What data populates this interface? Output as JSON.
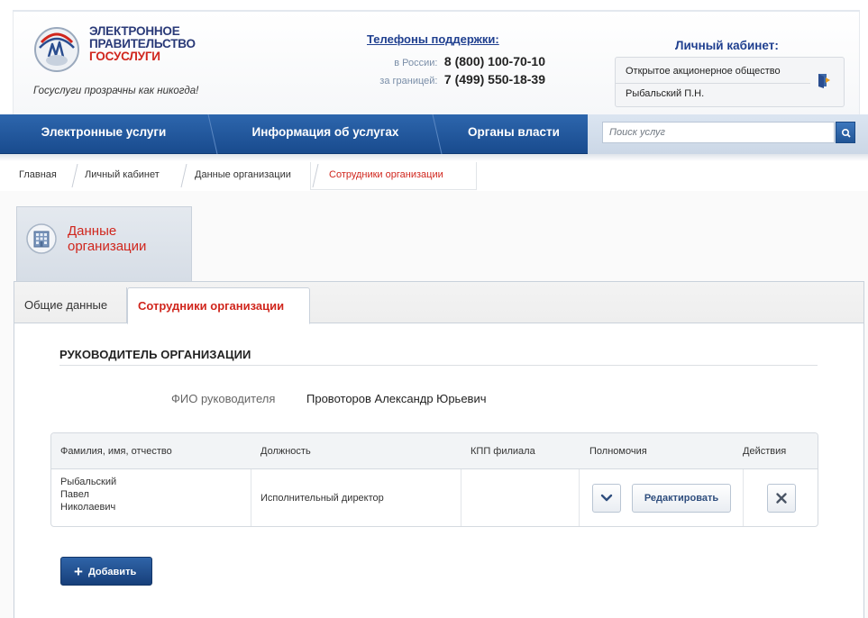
{
  "header": {
    "logo": {
      "line1": "ЭЛЕКТРОННОЕ",
      "line2": "ПРАВИТЕЛЬСТВО",
      "line3": "ГОСУСЛУГИ"
    },
    "slogan": "Госуслуги прозрачны как никогда!",
    "support": {
      "title": "Телефоны поддержки:",
      "russia_label": "в России:",
      "russia_number": "8 (800) 100-70-10",
      "abroad_label": "за границей:",
      "abroad_number": "7 (499) 550-18-39"
    },
    "cabinet": {
      "title": "Личный кабинет:",
      "organization": "Открытое акционерное общество",
      "user": "Рыбальский П.Н."
    }
  },
  "nav": {
    "items": [
      "Электронные услуги",
      "Информация об услугах",
      "Органы власти"
    ],
    "search_placeholder": "Поиск услуг"
  },
  "breadcrumb": [
    "Главная",
    "Личный кабинет",
    "Данные организации",
    "Сотрудники организации"
  ],
  "section": {
    "line1": "Данные",
    "line2": "организации"
  },
  "tabs": [
    "Общие данные",
    "Сотрудники организации"
  ],
  "head_block": {
    "title": "РУКОВОДИТЕЛЬ ОРГАНИЗАЦИИ",
    "label": "ФИО руководителя",
    "value": "Провоторов Александр Юрьевич"
  },
  "table": {
    "columns": [
      "Фамилия, имя, отчество",
      "Должность",
      "КПП филиала",
      "Полномочия",
      "Действия"
    ],
    "rows": [
      {
        "name_line1": "Рыбальский",
        "name_line2": "Павел",
        "name_line3": "Николаевич",
        "position": "Исполнительный директор",
        "kpp": "",
        "edit_label": "Редактировать"
      }
    ]
  },
  "add_button": "Добавить",
  "colors": {
    "brand_blue": "#1f4f8f",
    "accent_red": "#d0261d"
  }
}
